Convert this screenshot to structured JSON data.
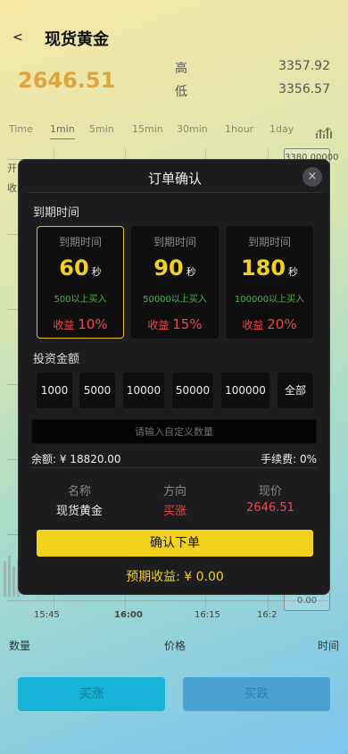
{
  "header": {
    "back_label": "<",
    "title": "现货黄金"
  },
  "price": {
    "current": "2646.51",
    "high_label": "高",
    "high_value": "3357.92",
    "low_label": "低",
    "low_value": "3356.57"
  },
  "timeframes": [
    "Time",
    "1min",
    "5min",
    "15min",
    "30min",
    "1hour",
    "1day"
  ],
  "active_timeframe": "1min",
  "chart": {
    "y_top": "3380.00000",
    "y_bottom": "0.00",
    "time_ticks": [
      "15:45",
      "16:00",
      "16:15",
      "16:2"
    ],
    "left_fragments": [
      "开",
      "收"
    ]
  },
  "list_headers": {
    "qty": "数量",
    "price": "价格",
    "time": "时间"
  },
  "actions": {
    "rise": "买涨",
    "fall": "买跌"
  },
  "modal": {
    "title": "订单确认",
    "close": "×",
    "expiry_label": "到期时间",
    "periods": [
      {
        "label": "到期时间",
        "seconds": "60",
        "unit": "秒",
        "min": "500以上买入",
        "profit_label": "收益",
        "profit_pct": "10%"
      },
      {
        "label": "到期时间",
        "seconds": "90",
        "unit": "秒",
        "min": "50000以上买入",
        "profit_label": "收益",
        "profit_pct": "15%"
      },
      {
        "label": "到期时间",
        "seconds": "180",
        "unit": "秒",
        "min": "100000以上买入",
        "profit_label": "收益",
        "profit_pct": "20%"
      }
    ],
    "amount_label": "投资金额",
    "amounts": [
      "1000",
      "5000",
      "10000",
      "50000",
      "100000",
      "全部"
    ],
    "custom_placeholder": "请输入自定义数量",
    "balance": "余额: ¥ 18820.00",
    "fee": "手续费: 0%",
    "info_headers": [
      "名称",
      "方向",
      "现价"
    ],
    "info_values": [
      "现货黄金",
      "买涨",
      "2646.51"
    ],
    "confirm_label": "确认下单",
    "expected": "预期收益: ¥ 0.00"
  },
  "colors": {
    "accent_gold": "#f1d01e",
    "profit_red": "#e84a4a",
    "min_green": "#3dbf3d",
    "price_orange": "#e0a43a"
  }
}
